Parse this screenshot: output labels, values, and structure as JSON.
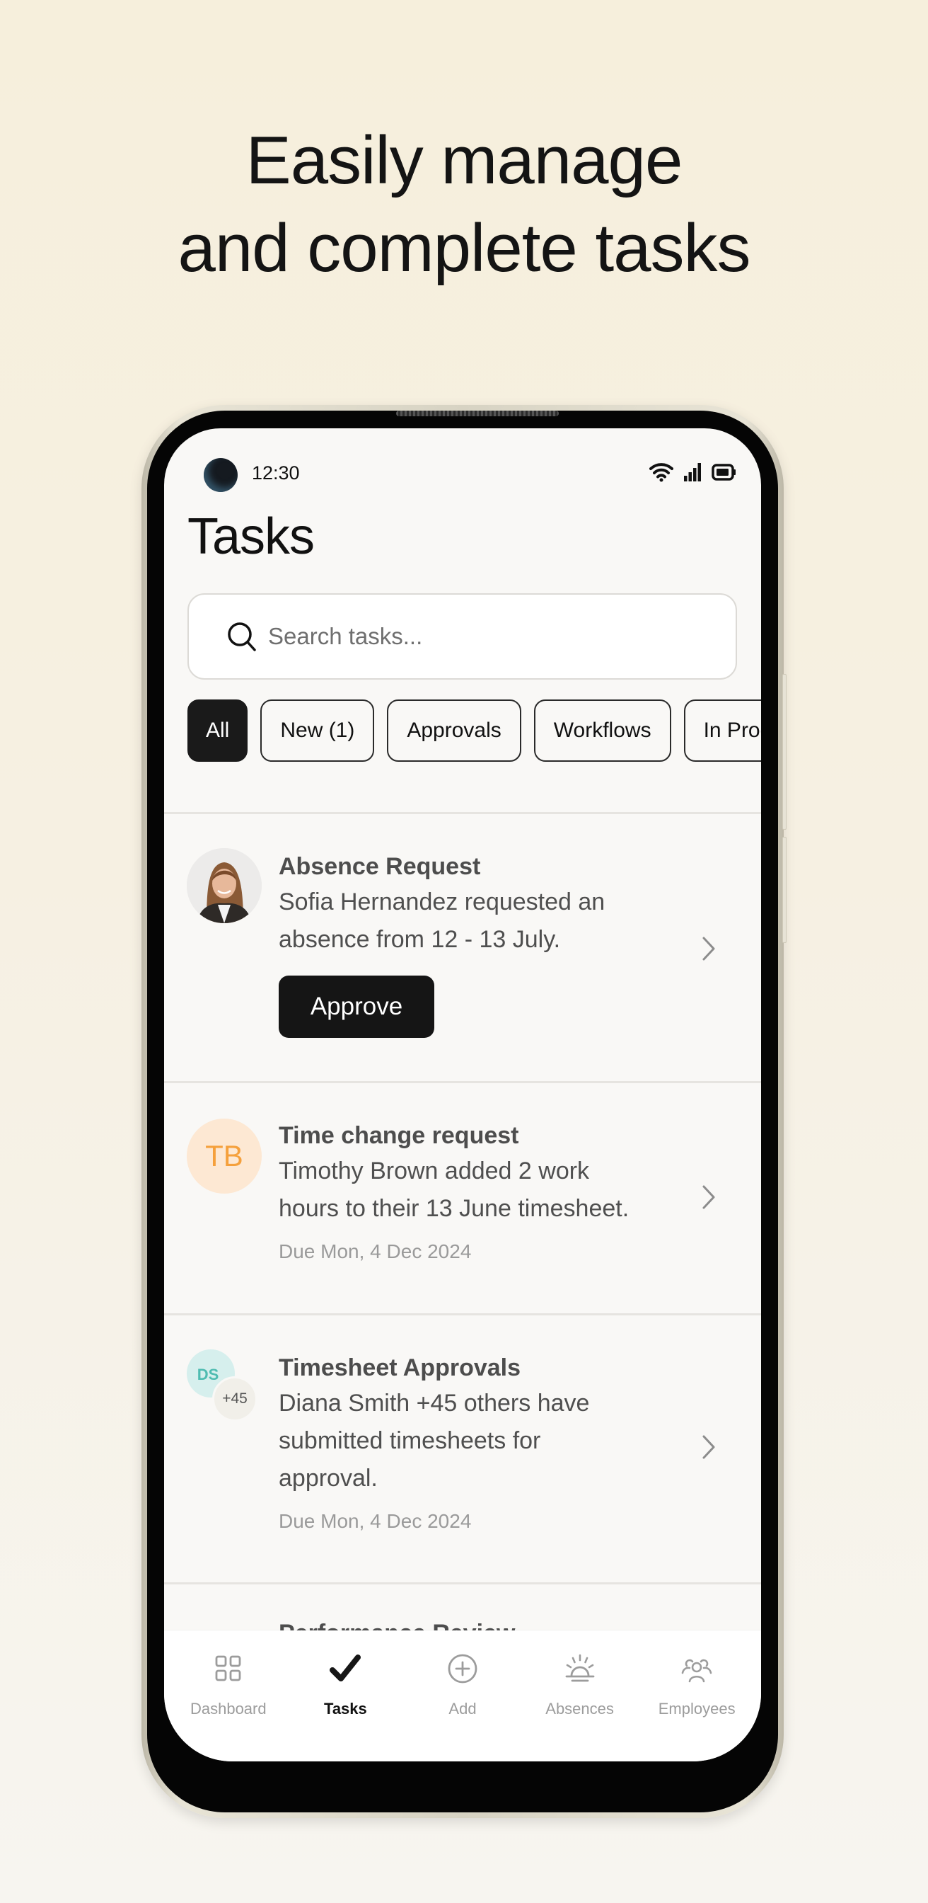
{
  "headline": {
    "line1": "Easily manage",
    "line2": "and complete tasks"
  },
  "status_bar": {
    "time": "12:30",
    "icons": [
      "wifi-icon",
      "signal-icon",
      "battery-icon"
    ]
  },
  "page": {
    "title": "Tasks"
  },
  "search": {
    "placeholder": "Search tasks...",
    "value": ""
  },
  "filters": {
    "selected": "All",
    "chips": [
      {
        "label": "All",
        "active": true
      },
      {
        "label": "New (1)",
        "active": false
      },
      {
        "label": "Approvals",
        "active": false
      },
      {
        "label": "Workflows",
        "active": false
      },
      {
        "label": "In Progress",
        "active": false
      }
    ]
  },
  "tasks": [
    {
      "title": "Absence Request",
      "description_lines": [
        "Sofia Hernandez requested an",
        "absence from 12 - 13 July."
      ],
      "avatar": {
        "type": "photo",
        "name": "Sofia Hernandez"
      },
      "action_label": "Approve"
    },
    {
      "title": "Time change request",
      "description_lines": [
        "Timothy Brown added 2 work",
        "hours to their 13 June timesheet."
      ],
      "avatar": {
        "type": "initials",
        "initials": "TB",
        "bg": "#fde8d3",
        "fg": "#f5a03c"
      },
      "due": "Due Mon, 4 Dec 2024"
    },
    {
      "title": "Timesheet Approvals",
      "description_lines": [
        "Diana Smith +45 others have",
        "submitted timesheets for",
        "approval."
      ],
      "avatar": {
        "type": "stack",
        "initials": "DS",
        "extra": "+45",
        "bg": "#d6efed",
        "fg": "#4fbcb1"
      },
      "due": "Due Mon, 4 Dec 2024"
    },
    {
      "title": "Performance Review",
      "partially_visible": true
    }
  ],
  "bottom_nav": {
    "items": [
      {
        "label": "Dashboard",
        "icon": "grid-icon",
        "active": false
      },
      {
        "label": "Tasks",
        "icon": "checkmark-icon",
        "active": true
      },
      {
        "label": "Add",
        "icon": "plus-circle-icon",
        "active": false
      },
      {
        "label": "Absences",
        "icon": "sunrise-icon",
        "active": false
      },
      {
        "label": "Employees",
        "icon": "people-icon",
        "active": false
      }
    ]
  },
  "colors": {
    "accent": "#151515",
    "background": "#f6efdc",
    "screen": "#f9f8f6"
  }
}
